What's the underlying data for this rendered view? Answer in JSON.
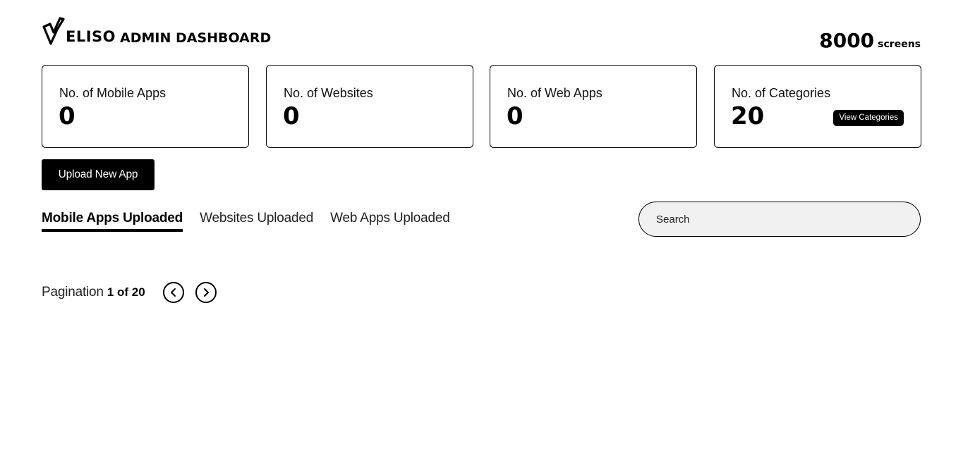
{
  "header": {
    "logo_text": "ELISO",
    "title": "ADMIN DASHBOARD",
    "screens_count": "8000",
    "screens_unit": "screens"
  },
  "stats": [
    {
      "label": "No. of Mobile Apps",
      "value": "0"
    },
    {
      "label": "No. of Websites",
      "value": "0"
    },
    {
      "label": "No. of Web Apps",
      "value": "0"
    },
    {
      "label": "No. of Categories",
      "value": "20",
      "button_label": "View Categories"
    }
  ],
  "actions": {
    "upload_label": "Upload New App"
  },
  "tabs": [
    {
      "label": "Mobile Apps Uploaded",
      "active": true
    },
    {
      "label": "Websites Uploaded",
      "active": false
    },
    {
      "label": "Web Apps Uploaded",
      "active": false
    }
  ],
  "search": {
    "placeholder": "Search",
    "value": ""
  },
  "pagination": {
    "label": "Pagination",
    "value": "1 of 20"
  },
  "icons": {
    "logo": "v-logo-icon",
    "prev": "chevron-left-circle-icon",
    "next": "chevron-right-circle-icon"
  }
}
